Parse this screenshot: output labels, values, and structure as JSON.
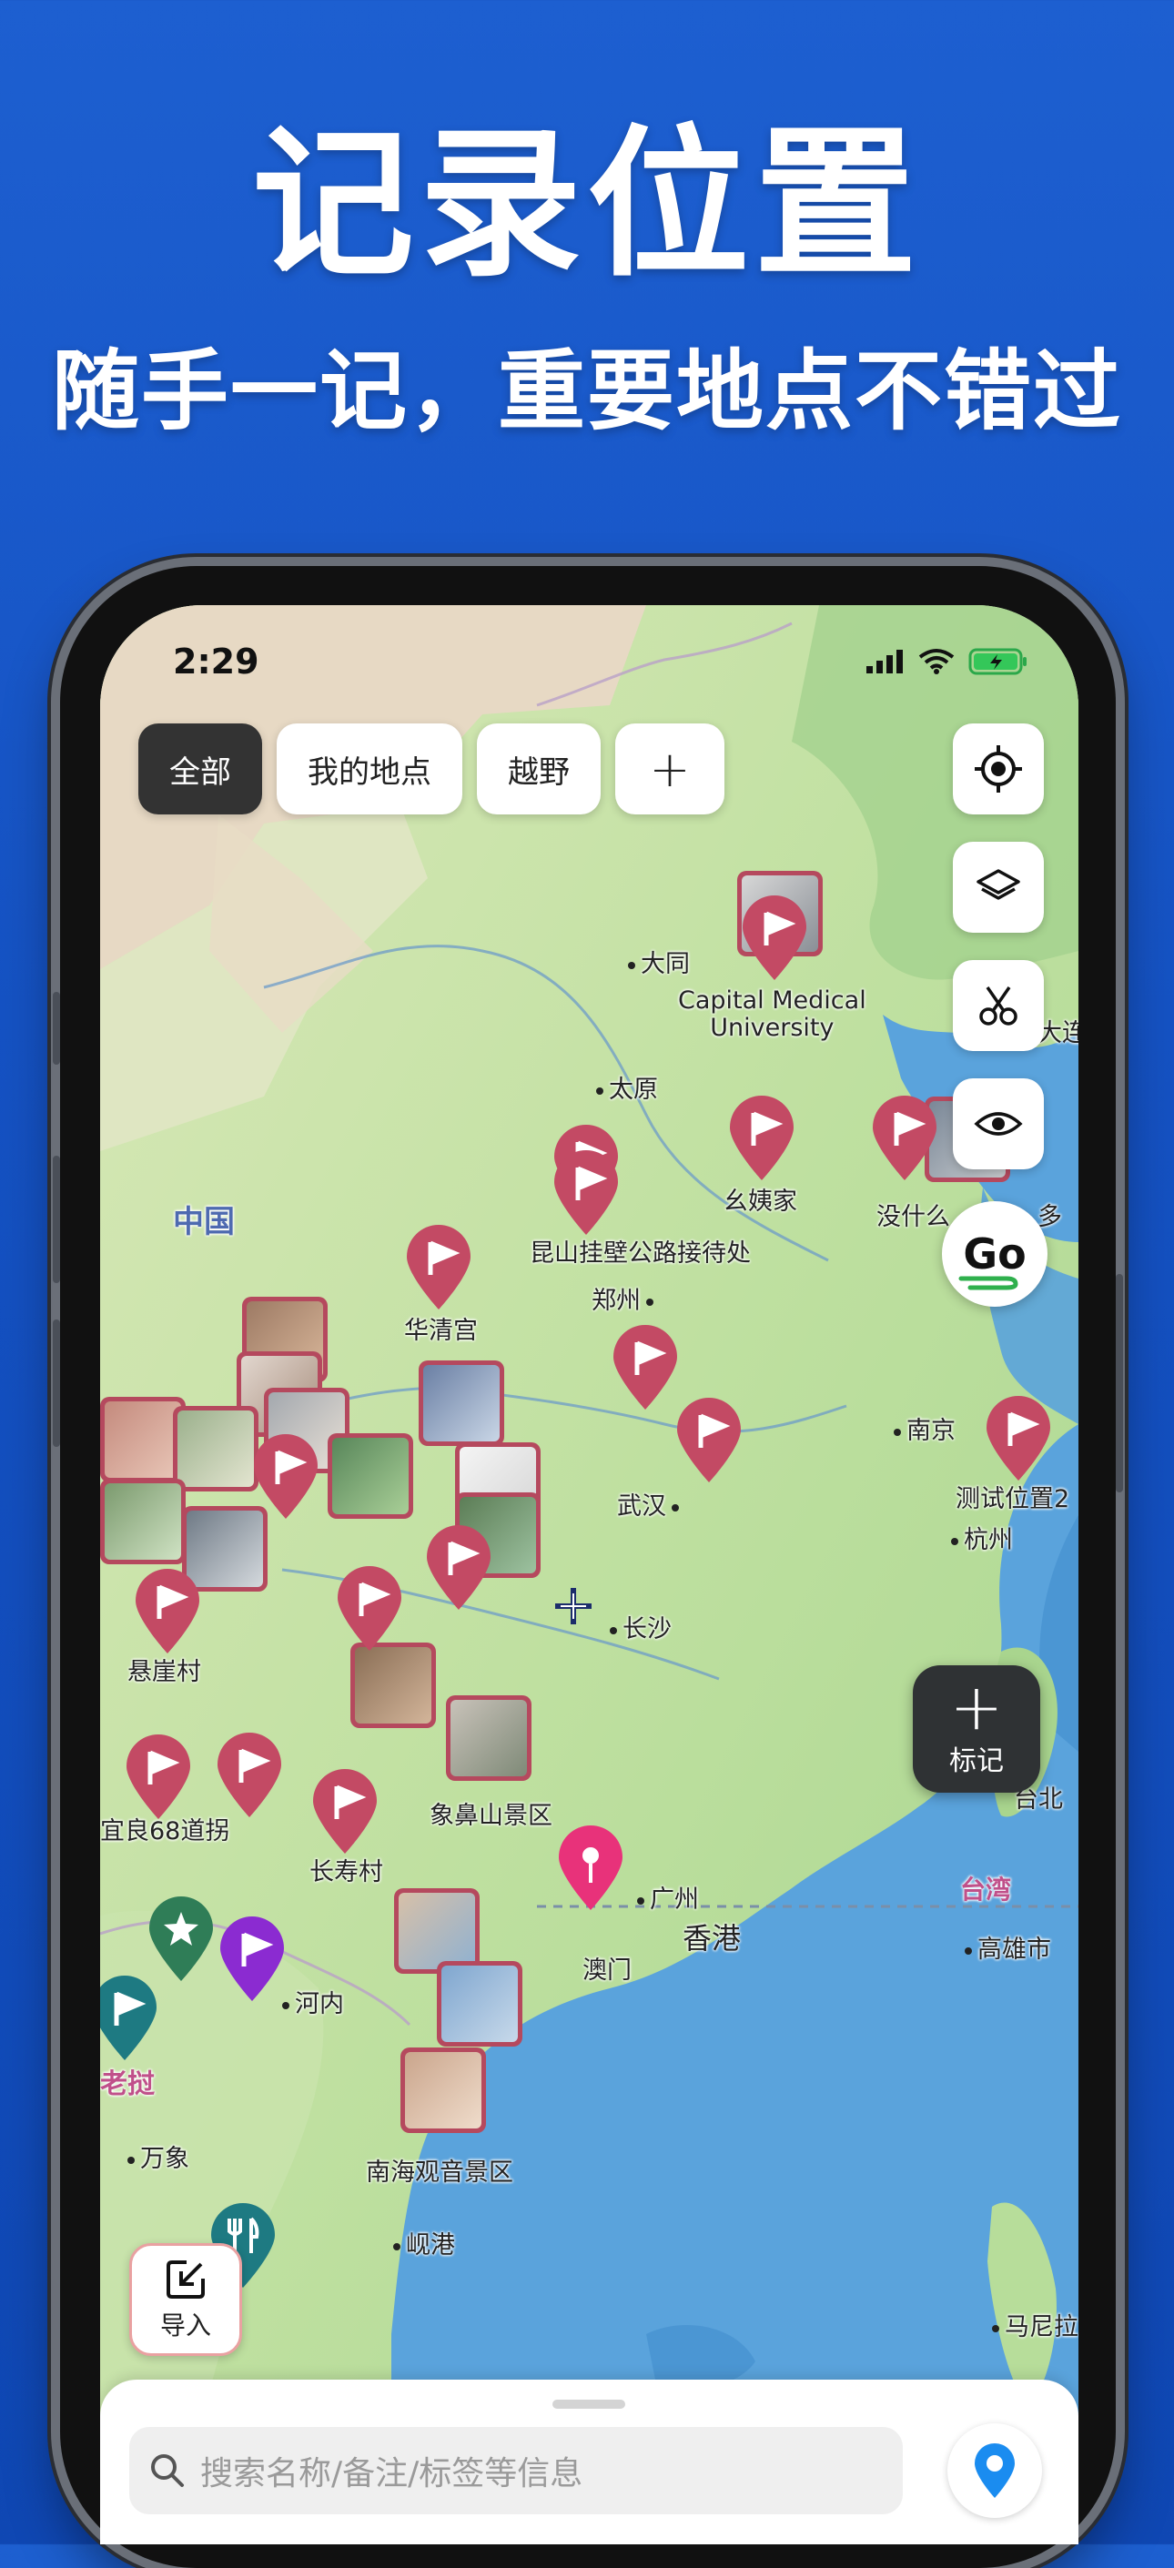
{
  "promo": {
    "title": "记录位置",
    "subtitle": "随手一记，重要地点不错过"
  },
  "status_bar": {
    "time": "2:29"
  },
  "filters": {
    "chips": [
      "全部",
      "我的地点",
      "越野"
    ],
    "add": "+"
  },
  "controls": {
    "locate": "locate-icon",
    "layers": "layers-icon",
    "scissors": "scissors-icon",
    "visibility": "eye-icon",
    "go": "Go"
  },
  "mark_button": {
    "plus": "+",
    "label": "标记"
  },
  "import_button": {
    "label": "导入"
  },
  "map_labels": {
    "datong": "大同",
    "capital": "Capital Medical\nUniversity",
    "dalian": "大连",
    "taiyuan": "太原",
    "yiyijia": "幺姨家",
    "meiyou": "没什么",
    "duo": "多",
    "kunshan": "昆山挂壁公路接待处",
    "zhengzhou": "郑州",
    "zhongguo": "中国",
    "huaqinggong": "华清宫",
    "nanjing": "南京",
    "ceshi": "测试位置2",
    "hangzhou": "杭州",
    "wuhan": "武汉",
    "changsha": "长沙",
    "xuanya": "悬崖村",
    "yiliang": "宜良68道拐",
    "changshou": "长寿村",
    "xiangbi": "象鼻山景区",
    "taibei": "台北",
    "taiwan": "台湾",
    "guangzhou": "广州",
    "xianggang": "香港",
    "aomen": "澳门",
    "gaoxiong": "高雄市",
    "henei": "河内",
    "laowo": "老挝",
    "wanxiang": "万象",
    "nanhai": "南海观音景区",
    "xiangang": "岘港",
    "malai": "马尼拉"
  },
  "bottom_sheet": {
    "search_placeholder": "搜索名称/备注/标签等信息"
  },
  "colors": {
    "accent": "#1d5fd0",
    "pin": "#c34a64",
    "pin_special": "#e8327a",
    "pin_purple": "#8b2bd1",
    "pin_green": "#2f7d57",
    "pin_teal": "#1e7a82",
    "water": "#5aa3dc"
  }
}
